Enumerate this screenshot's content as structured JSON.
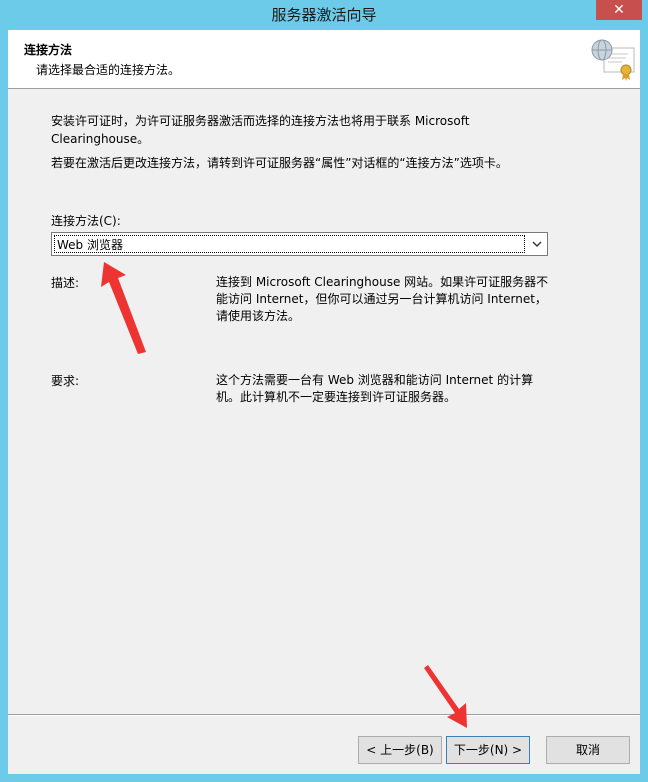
{
  "window": {
    "title": "服务器激活向导",
    "close_glyph": "✕"
  },
  "header": {
    "title": "连接方法",
    "subtitle": "请选择最合适的连接方法。",
    "icon": "certificate-icon"
  },
  "body": {
    "intro": "安装许可证时，为许可证服务器激活而选择的连接方法也将用于联系 Microsoft Clearinghouse。",
    "intro2": "若要在激活后更改连接方法，请转到许可证服务器“属性”对话框的“连接方法”选项卡。",
    "connection_label": "连接方法(C):",
    "connection_value": "Web 浏览器",
    "description_label": "描述:",
    "description_text": "连接到 Microsoft Clearinghouse 网站。如果许可证服务器不能访问 Internet，但你可以通过另一台计算机访问 Internet，请使用该方法。",
    "requirements_label": "要求:",
    "requirements_text": "这个方法需要一台有 Web 浏览器和能访问 Internet 的计算机。此计算机不一定要连接到许可证服务器。"
  },
  "buttons": {
    "back": "< 上一步(B)",
    "next": "下一步(N) >",
    "cancel": "取消"
  },
  "colors": {
    "titlebar": "#6ccbe9",
    "close": "#c7504f",
    "annotation_arrow": "#ee3333"
  }
}
